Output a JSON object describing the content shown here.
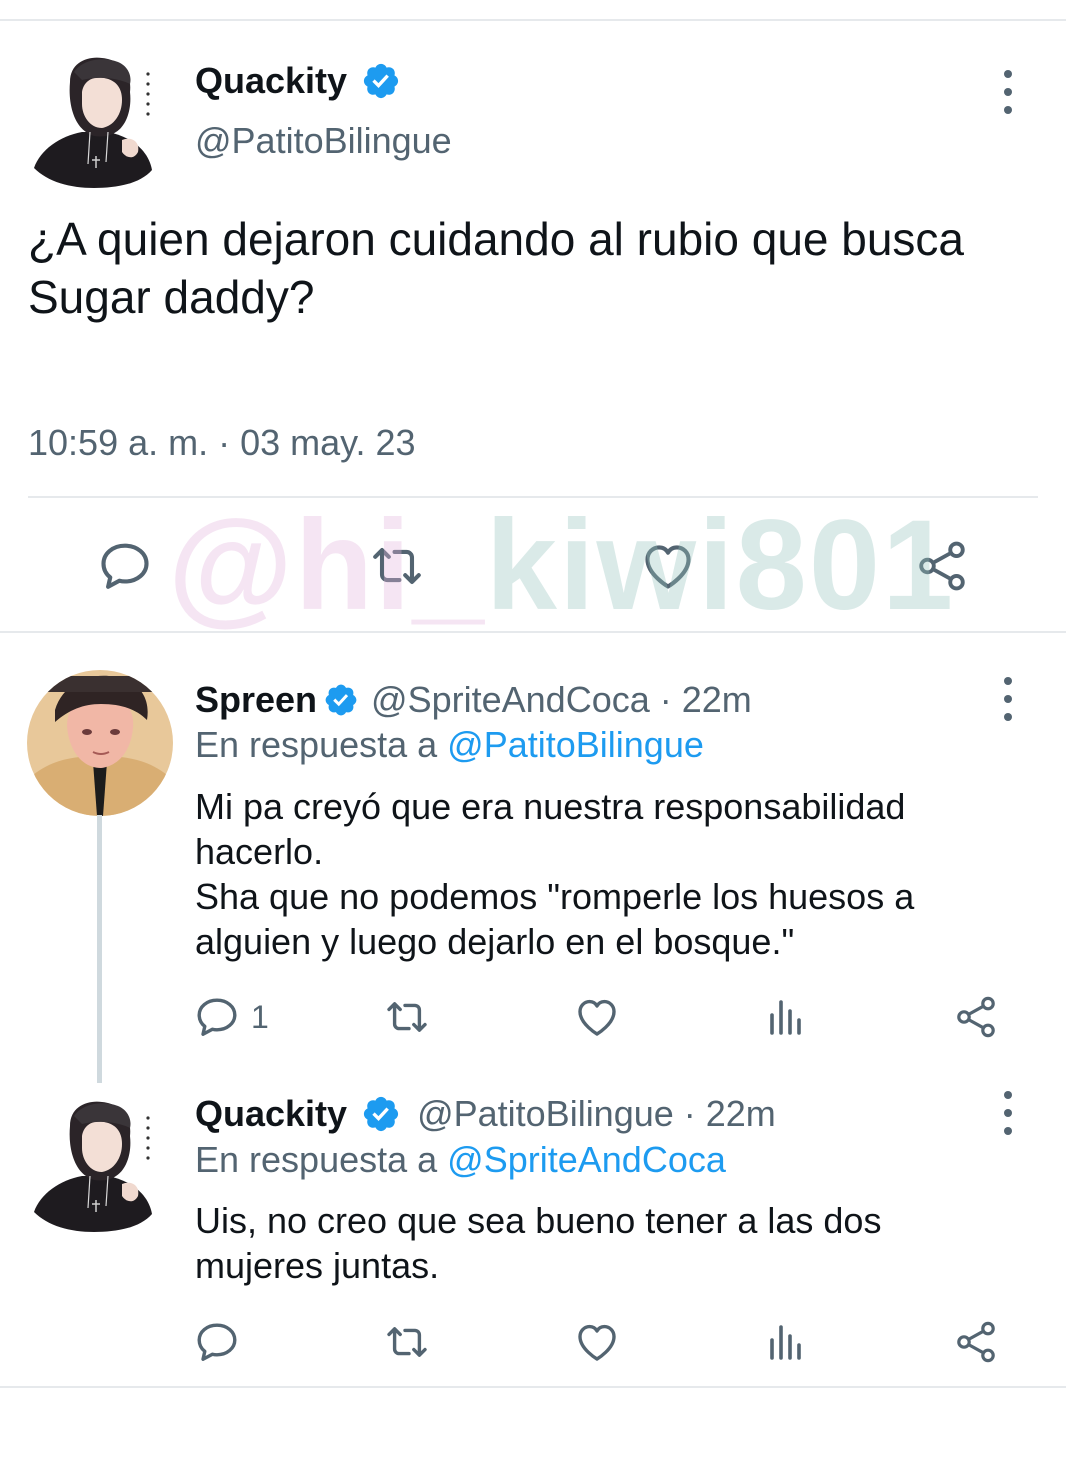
{
  "main_tweet": {
    "author_name": "Quackity",
    "handle": "@PatitoBilingue",
    "text_line1": "¿A quien dejaron cuidando al rubio que busca",
    "text_line2": "Sugar daddy?",
    "timestamp": "10:59 a. m. · 03 may. 23"
  },
  "watermark": {
    "part1": "@hi_",
    "part2": "kiwi801"
  },
  "replies": [
    {
      "author_name": "Spreen",
      "meta": "@SpriteAndCoca · 22m",
      "reply_prefix": "En respuesta a ",
      "reply_mention": "@PatitoBilingue",
      "text_lines": [
        "Mi pa creyó que era nuestra responsabilidad",
        "hacerlo.",
        "Sha que no podemos \"romperle los huesos a",
        "alguien y luego dejarlo en el bosque.\""
      ],
      "reply_count": "1"
    },
    {
      "author_name": "Quackity",
      "meta": "@PatitoBilingue · 22m",
      "reply_prefix": "En respuesta a ",
      "reply_mention": "@SpriteAndCoca",
      "text_lines": [
        "Uis, no creo que sea bueno tener a las dos",
        "mujeres juntas."
      ]
    }
  ],
  "icons": {
    "verified": "verified-badge-icon",
    "more": "more-options-icon",
    "reply": "reply-icon",
    "retweet": "retweet-icon",
    "like": "like-icon",
    "views": "views-icon",
    "share": "share-icon"
  },
  "colors": {
    "text": "#0f1419",
    "secondary": "#536471",
    "accent": "#1d9bf0",
    "divider": "#e6e9ec"
  }
}
